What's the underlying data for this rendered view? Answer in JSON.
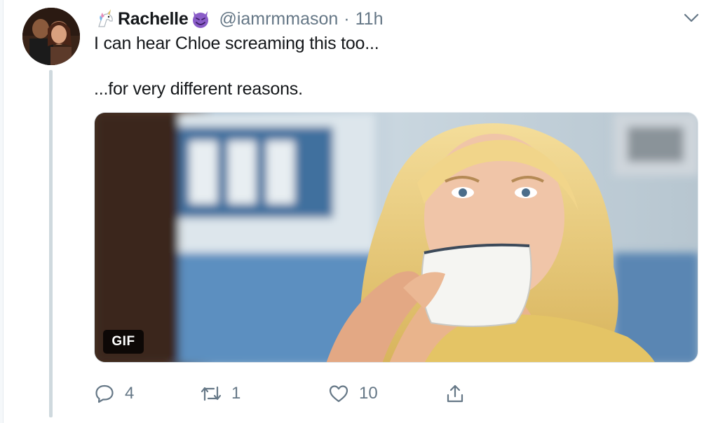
{
  "tweet": {
    "display_name": "Rachelle",
    "handle": "@iamrmmason",
    "separator": "·",
    "time": "11h",
    "name_prefix_emoji": "unicorn-icon",
    "name_suffix_emoji": "smiling-devil-icon",
    "text_line_1": "I can hear Chloe screaming this too...",
    "text_line_2": "...for very different reasons.",
    "media": {
      "badge": "GIF"
    },
    "actions": {
      "reply_count": "4",
      "retweet_count": "1",
      "like_count": "10"
    }
  },
  "colors": {
    "text": "#14171a",
    "secondary": "#657786",
    "thread_line": "#cfd9de",
    "devil_purple": "#8a5cc8"
  }
}
